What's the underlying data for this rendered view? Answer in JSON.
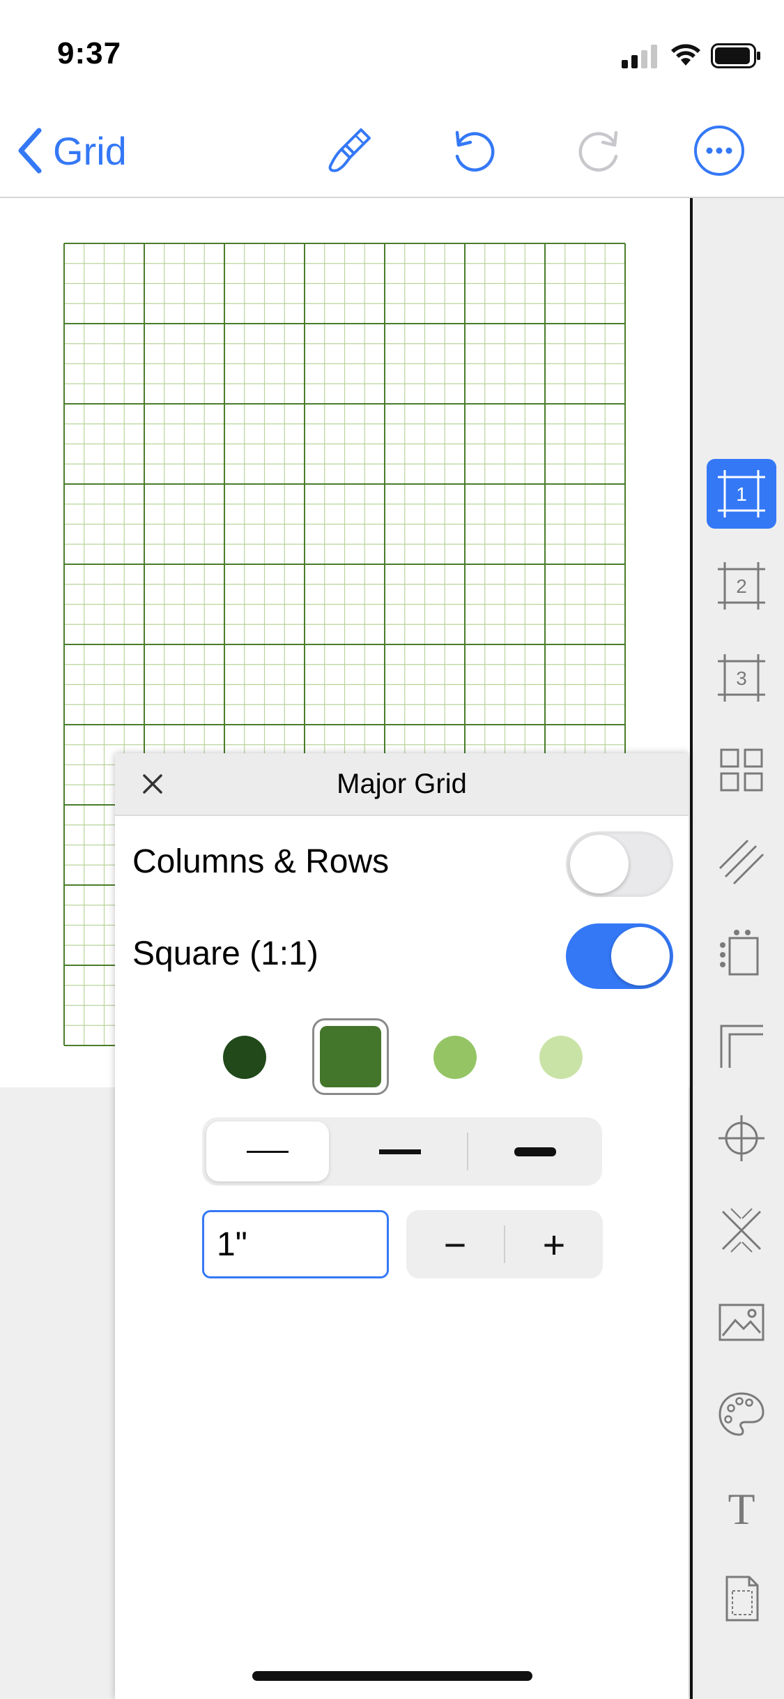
{
  "status_bar": {
    "time": "9:37"
  },
  "nav": {
    "back_label": "Grid",
    "accent": "#3478f6"
  },
  "grid": {
    "columns": 7,
    "rows": 10,
    "subdivisions": 4,
    "major_color": "#4a7d2a",
    "minor_color": "#b9d49a"
  },
  "toolbar": {
    "items": [
      {
        "name": "layer-1",
        "label": "1",
        "active": true
      },
      {
        "name": "layer-2",
        "label": "2",
        "active": false
      },
      {
        "name": "layer-3",
        "label": "3",
        "active": false
      },
      {
        "name": "grid-layout",
        "active": false
      },
      {
        "name": "diagonal-lines",
        "active": false
      },
      {
        "name": "dot-margin",
        "active": false
      },
      {
        "name": "corner",
        "active": false
      },
      {
        "name": "crosshair",
        "active": false
      },
      {
        "name": "x-pattern",
        "active": false
      },
      {
        "name": "image",
        "active": false
      },
      {
        "name": "palette",
        "active": false
      },
      {
        "name": "text",
        "label": "T",
        "active": false
      },
      {
        "name": "page",
        "active": false
      }
    ]
  },
  "panel": {
    "title": "Major Grid",
    "columns_rows_label": "Columns & Rows",
    "columns_rows_on": false,
    "square_label": "Square (1:1)",
    "square_on": true,
    "swatches": [
      "#21491a",
      "#43752a",
      "#95c465",
      "#c9e3a6"
    ],
    "selected_swatch": 1,
    "line_weight_selected": 0,
    "size_value": "1\"",
    "stepper_minus": "−",
    "stepper_plus": "+"
  }
}
